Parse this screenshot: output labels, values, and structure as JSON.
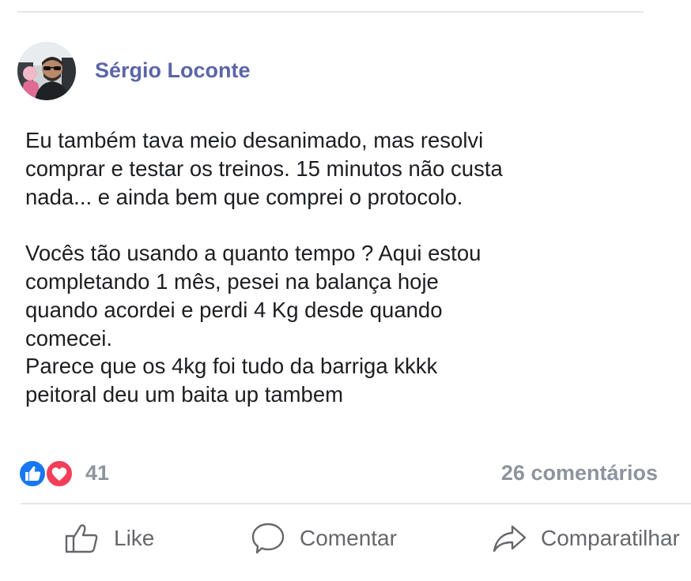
{
  "post": {
    "author": "Sérgio Loconte",
    "body": "Eu também tava meio desanimado, mas resolvi\ncomprar e testar os treinos. 15 minutos não custa\nnada... e ainda bem que comprei o protocolo.\n\nVocês tão usando a quanto tempo ? Aqui estou\ncompletando 1 mês, pesei na balança hoje\nquando acordei e perdi 4 Kg desde quando\ncomecei.\nParece que os 4kg foi tudo da barriga kkkk\npeitoral deu um baita up tambem"
  },
  "reactions": {
    "count": "41",
    "types": [
      "like-reaction-icon",
      "love-reaction-icon"
    ],
    "like_color": "#1877f2",
    "love_color": "#f33e58"
  },
  "comments": {
    "count_label": "26 comentários"
  },
  "actions": {
    "like_label": "Like",
    "comment_label": "Comentar",
    "share_label": "Comparatilhar"
  },
  "colors": {
    "author": "#5b65a8",
    "muted": "#8d949e",
    "action_text": "#65676b",
    "divider": "#e4e6eb"
  }
}
